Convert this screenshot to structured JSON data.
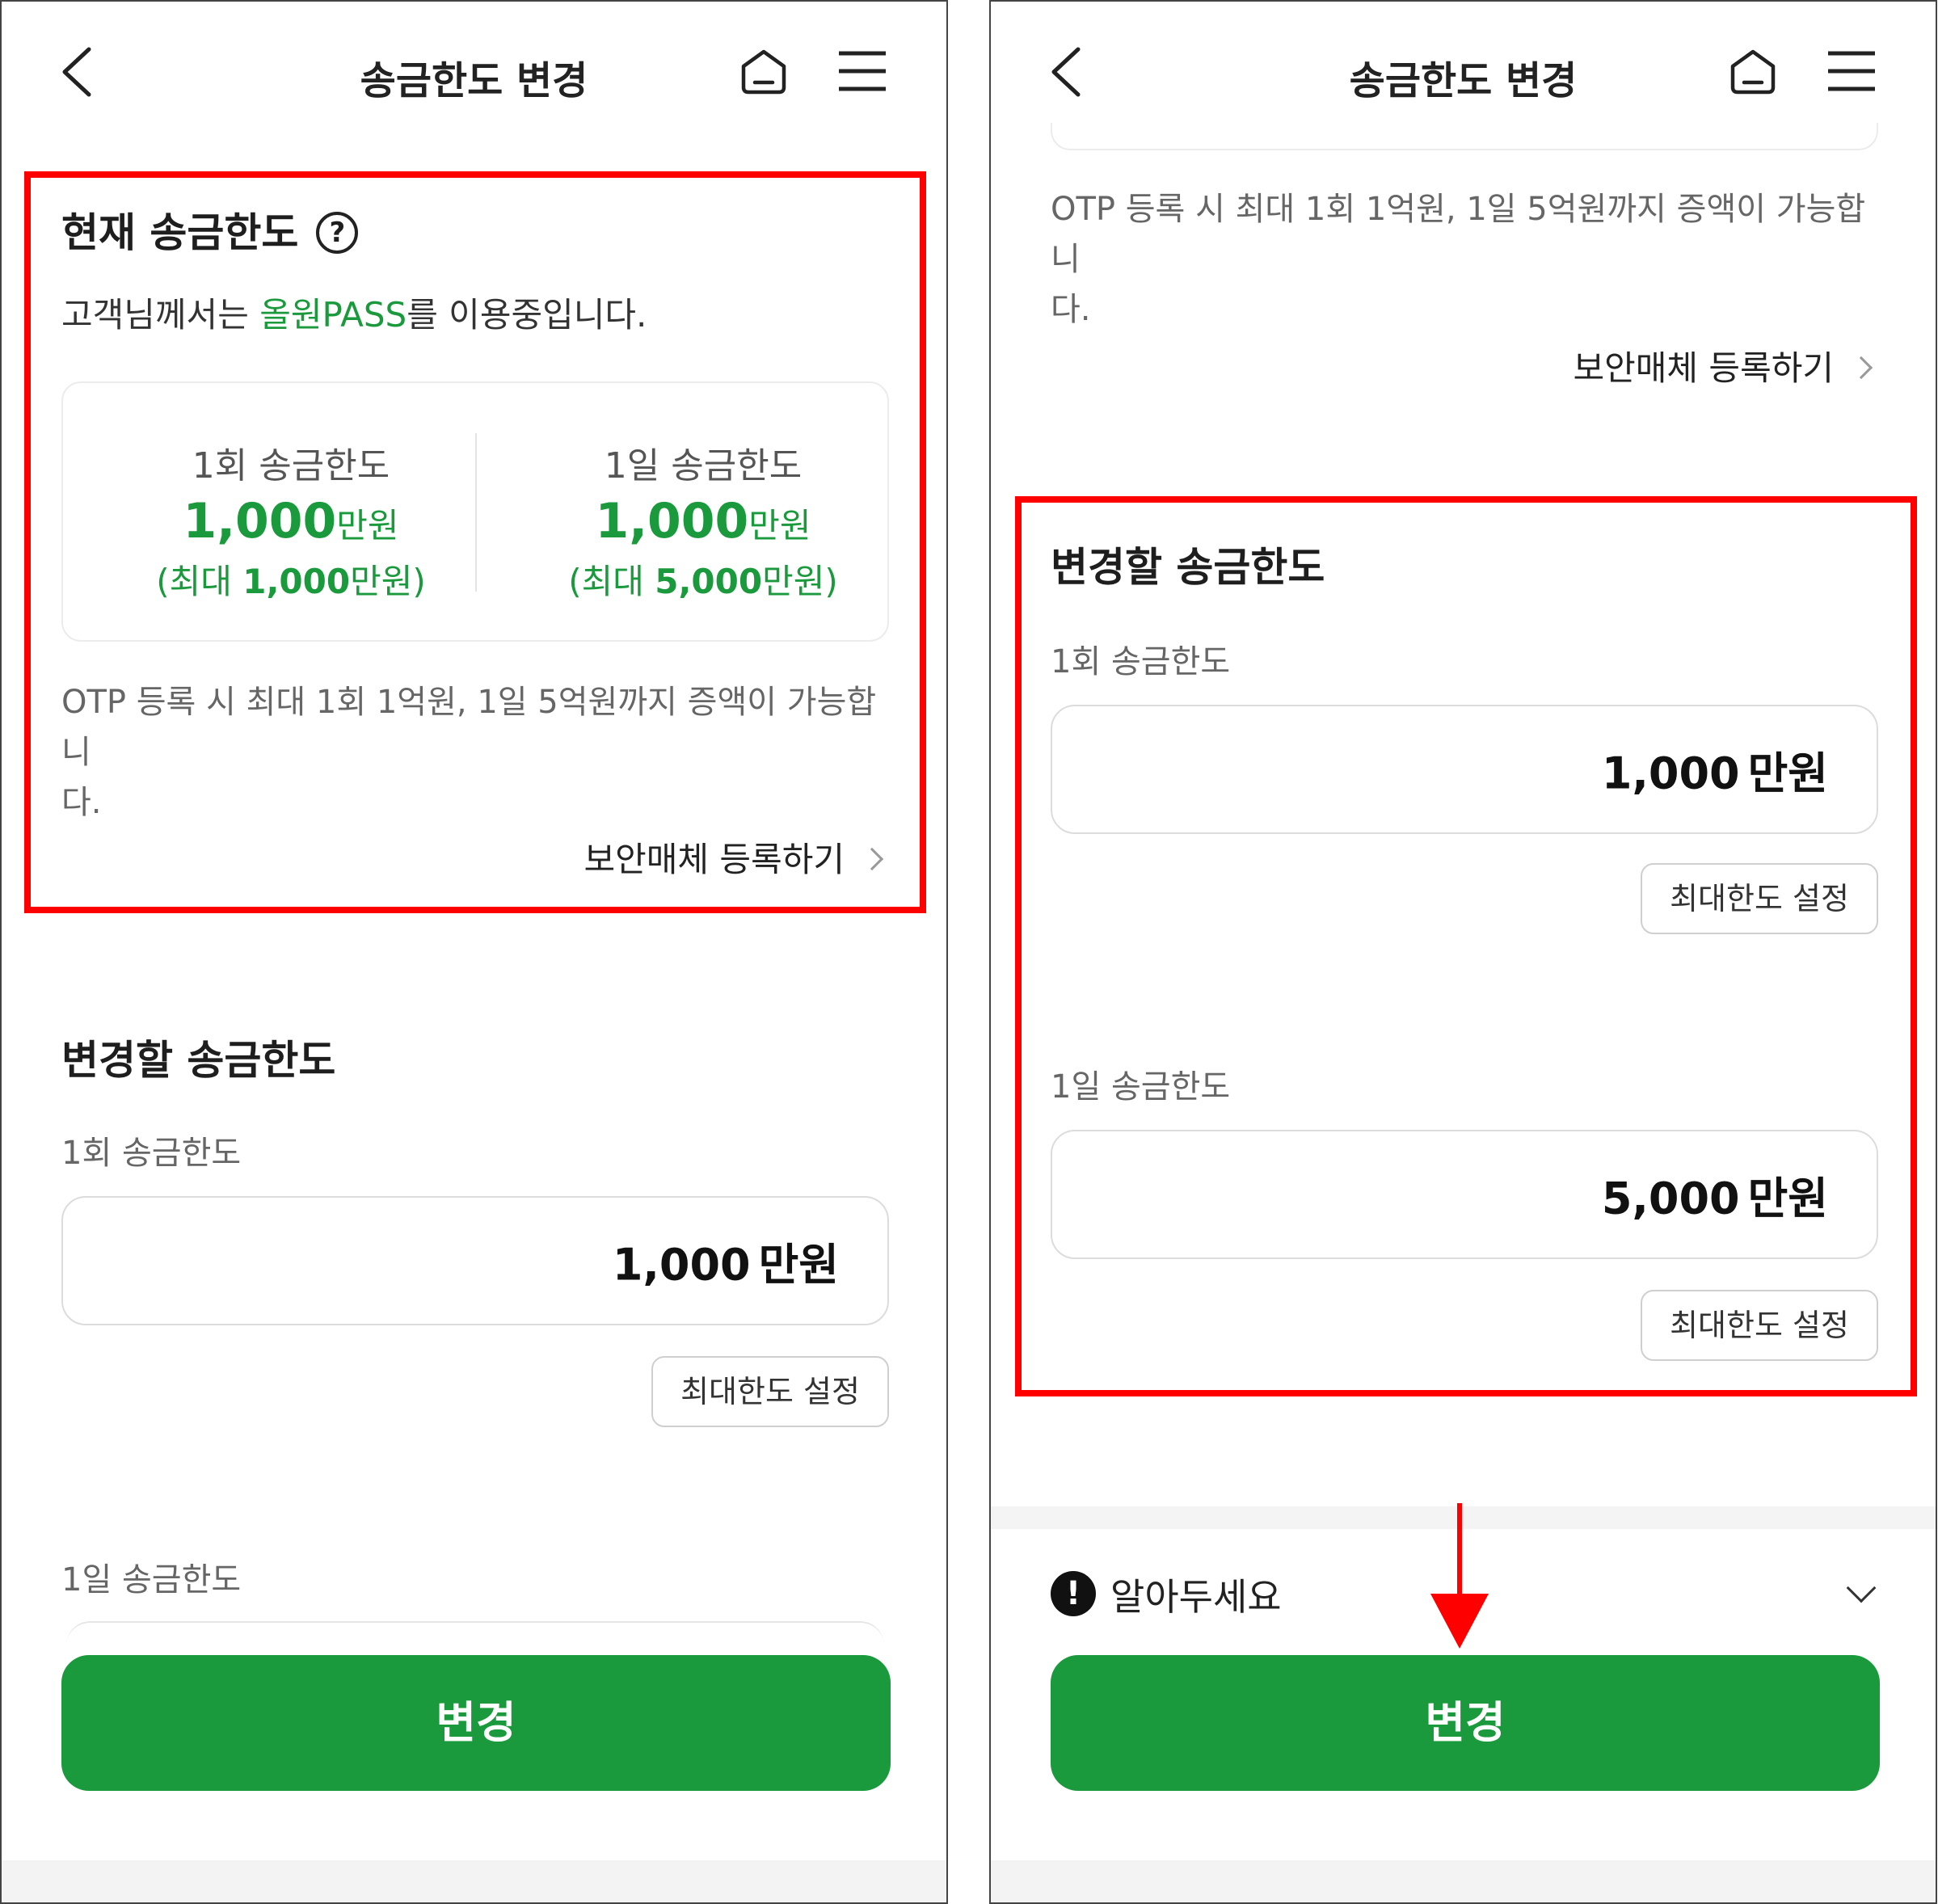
{
  "header": {
    "title": "송금한도 변경"
  },
  "current": {
    "heading": "현재 송금한도",
    "help_symbol": "?",
    "desc_prefix": "고객님께서는 ",
    "desc_highlight": "올원PASS",
    "desc_suffix": "를 이용중입니다.",
    "per_tx": {
      "title": "1회 송금한도",
      "amount": "1,000",
      "unit": "만원",
      "max_prefix": "(최대 ",
      "max_value": "1,000",
      "max_suffix": "만원)"
    },
    "per_day": {
      "title": "1일 송금한도",
      "amount": "1,000",
      "unit": "만원",
      "max_prefix": "(최대 ",
      "max_value": "5,000",
      "max_suffix": "만원)"
    },
    "otp_note_line1": "OTP 등록 시 최대 1회 1억원, 1일 5억원까지 증액이 가능합니",
    "otp_note_line2": "다.",
    "register_link": "보안매체 등록하기"
  },
  "change": {
    "heading": "변경할 송금한도",
    "per_tx_label": "1회 송금한도",
    "per_tx_value": "1,000",
    "per_day_label": "1일 송금한도",
    "per_day_value": "5,000",
    "unit": "만원",
    "max_button": "최대한도 설정"
  },
  "notice": {
    "icon_symbol": "!",
    "label": "알아두세요"
  },
  "submit_button": "변경",
  "annotation_color": "#ff0000",
  "accent_green": "#1a9a3c"
}
